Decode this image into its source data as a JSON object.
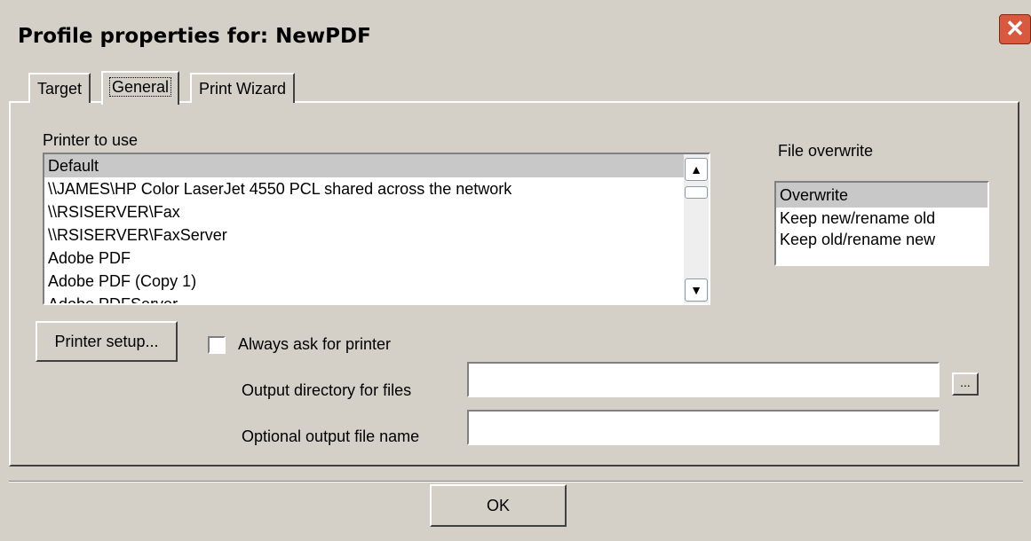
{
  "window": {
    "title": "Profile properties for: NewPDF",
    "close_glyph": "✕"
  },
  "tabs": [
    {
      "label": "Target"
    },
    {
      "label": "General"
    },
    {
      "label": "Print Wizard"
    }
  ],
  "general": {
    "printer_label": "Printer to use",
    "printers": [
      "Default",
      "\\\\JAMES\\HP Color LaserJet 4550 PCL shared across the network",
      "\\\\RSISERVER\\Fax",
      "\\\\RSISERVER\\FaxServer",
      "Adobe PDF",
      "Adobe PDF (Copy 1)",
      "Adobe PDFServer"
    ],
    "selected_printer": "Default",
    "file_overwrite_label": "File overwrite",
    "overwrite_options": [
      "Overwrite",
      "Keep new/rename old",
      "Keep old/rename new"
    ],
    "selected_overwrite": "Overwrite",
    "printer_setup_label": "Printer setup...",
    "always_ask_label": "Always ask for printer",
    "always_ask_checked": false,
    "output_dir_label": "Output directory for files",
    "output_dir_value": "",
    "browse_label": "...",
    "output_name_label": "Optional output file name",
    "output_name_value": ""
  },
  "footer": {
    "ok_label": "OK"
  }
}
